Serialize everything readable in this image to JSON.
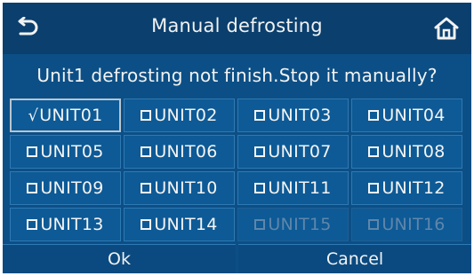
{
  "header": {
    "title": "Manual defrosting",
    "back_icon": "back-arrow-icon",
    "home_icon": "home-icon"
  },
  "message": "Unit1 defrosting not finish.Stop it manually?",
  "units": [
    {
      "label": "UNIT01",
      "mark": "√",
      "state": "checked"
    },
    {
      "label": "UNIT02",
      "mark": "box",
      "state": "unchecked"
    },
    {
      "label": "UNIT03",
      "mark": "box",
      "state": "unchecked"
    },
    {
      "label": "UNIT04",
      "mark": "box",
      "state": "unchecked"
    },
    {
      "label": "UNIT05",
      "mark": "box",
      "state": "unchecked"
    },
    {
      "label": "UNIT06",
      "mark": "box",
      "state": "unchecked"
    },
    {
      "label": "UNIT07",
      "mark": "box",
      "state": "unchecked"
    },
    {
      "label": "UNIT08",
      "mark": "box",
      "state": "unchecked"
    },
    {
      "label": "UNIT09",
      "mark": "box",
      "state": "unchecked"
    },
    {
      "label": "UNIT10",
      "mark": "box",
      "state": "unchecked"
    },
    {
      "label": "UNIT11",
      "mark": "box",
      "state": "unchecked"
    },
    {
      "label": "UNIT12",
      "mark": "box",
      "state": "unchecked"
    },
    {
      "label": "UNIT13",
      "mark": "box",
      "state": "unchecked"
    },
    {
      "label": "UNIT14",
      "mark": "box",
      "state": "unchecked"
    },
    {
      "label": "UNIT15",
      "mark": "box",
      "state": "disabled"
    },
    {
      "label": "UNIT16",
      "mark": "box",
      "state": "disabled"
    }
  ],
  "buttons": {
    "ok_label": "Ok",
    "cancel_label": "Cancel"
  },
  "colors": {
    "panel": "#0c4f86",
    "titlebar": "#0a3f6e",
    "text": "#f2f2f2",
    "disabled_text": "#5f86aa"
  }
}
